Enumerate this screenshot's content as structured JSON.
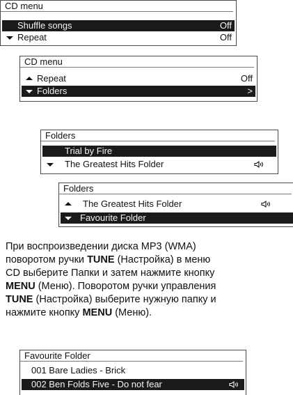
{
  "panels": {
    "cd1": {
      "title": "CD menu",
      "rows": [
        {
          "label": "Shuffle songs",
          "value": "Off"
        },
        {
          "label": "Repeat",
          "value": "Off"
        }
      ]
    },
    "cd2": {
      "title": "CD menu",
      "rows": [
        {
          "label": "Repeat",
          "value": "Off"
        },
        {
          "label": "Folders",
          "value": ">"
        }
      ]
    },
    "folders1": {
      "title": "Folders",
      "rows": [
        {
          "label": "Trial by Fire"
        },
        {
          "label": "The Greatest Hits Folder"
        }
      ]
    },
    "folders2": {
      "title": "Folders",
      "rows": [
        {
          "label": "The Greatest Hits Folder"
        },
        {
          "label": "Favourite Folder"
        }
      ]
    },
    "fav": {
      "title": "Favourite Folder",
      "rows": [
        {
          "label": "001 Bare Ladies - Brick"
        },
        {
          "label": "002 Ben Folds Five - Do not fear"
        }
      ]
    }
  },
  "instructions": {
    "l1": "При воспроизведении диска MP3 (WMA)",
    "l2a": "поворотом ручки ",
    "l2b": "TUNE",
    "l2c": " (Настройка) в меню",
    "l3": "CD выберите Папки и затем нажмите кнопку",
    "l4a": "MENU",
    "l4b": " (Меню). Поворотом ручки управления",
    "l5a": "TUNE",
    "l5b": " (Настройка) выберите нужную папку и",
    "l6a": "нажмите кнопку ",
    "l6b": "MENU",
    "l6c": " (Меню)."
  },
  "icons": [
    "down-arrow-icon",
    "up-arrow-icon",
    "speaker-icon"
  ]
}
